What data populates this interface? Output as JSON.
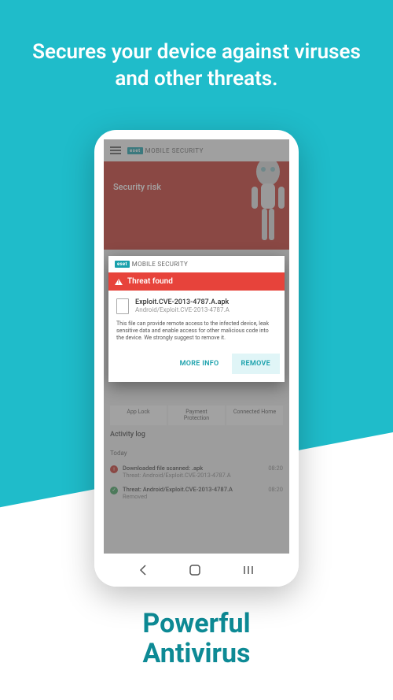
{
  "promo": {
    "headline": "Secures your device against viruses and other threats.",
    "tagline_l1": "Powerful",
    "tagline_l2": "Antivirus"
  },
  "app": {
    "brand_prefix": "eset",
    "brand_name": "MOBILE SECURITY",
    "status_title": "Security risk"
  },
  "modal": {
    "brand_prefix": "eset",
    "brand_name": "MOBILE SECURITY",
    "threat_header": "Threat found",
    "file_name": "Exploit.CVE-2013-4787.A.apk",
    "threat_name": "Android/Exploit.CVE-2013-4787.A",
    "description": "This file can provide remote access to the infected device, leak sensitive data and enable access for other malicious code into the device. We strongly suggest to remove it.",
    "more_info": "MORE INFO",
    "remove": "REMOVE"
  },
  "tiles": {
    "t1": "App Lock",
    "t2_l1": "Payment",
    "t2_l2": "Protection",
    "t3": "Connected Home"
  },
  "activity": {
    "title": "Activity log",
    "day": "Today",
    "items": [
      {
        "main": "Downloaded file scanned: .apk",
        "sec": "Threat: Android/Exploit.CVE-2013-4787.A",
        "time": "08:20"
      },
      {
        "main": "Threat: Android/Exploit.CVE-2013-4787.A",
        "sec": "Removed",
        "time": "08:20"
      }
    ]
  }
}
